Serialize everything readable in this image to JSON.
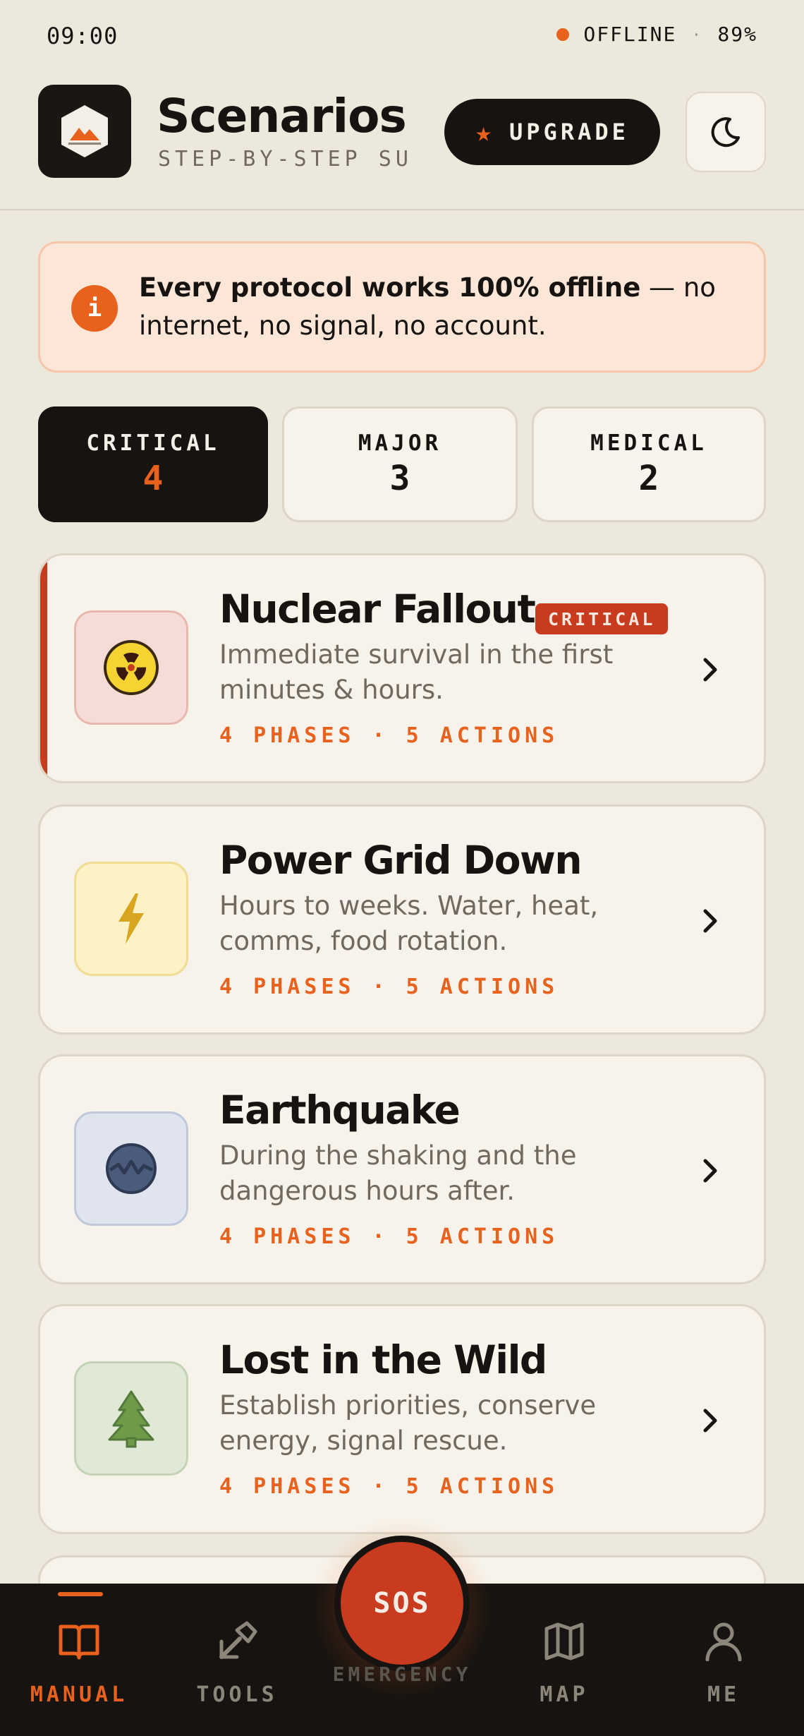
{
  "status_bar": {
    "time": "09:00",
    "network": "OFFLINE",
    "separator": "·",
    "battery": "89%"
  },
  "header": {
    "title": "Scenarios",
    "subtitle": "STEP-BY-STEP SU…",
    "upgrade_label": "UPGRADE",
    "upgrade_icon": "star-icon",
    "theme_icon": "moon-icon"
  },
  "banner": {
    "icon": "i",
    "bold": "Every protocol works 100% offline",
    "rest": " — no internet, no signal, no account."
  },
  "filters": [
    {
      "label": "CRITICAL",
      "count": "4",
      "active": true
    },
    {
      "label": "MAJOR",
      "count": "3",
      "active": false
    },
    {
      "label": "MEDICAL",
      "count": "2",
      "active": false
    }
  ],
  "scenarios": [
    {
      "title": "Nuclear Fallout",
      "badge": "CRITICAL",
      "description": "Immediate survival in the first minutes & hours.",
      "meta": "4 PHASES · 5 ACTIONS",
      "icon": "radiation-icon"
    },
    {
      "title": "Power Grid Down",
      "description": "Hours to weeks. Water, heat, comms, food rotation.",
      "meta": "4 PHASES · 5 ACTIONS",
      "icon": "lightning-icon"
    },
    {
      "title": "Earthquake",
      "description": "During the shaking and the dangerous hours after.",
      "meta": "4 PHASES · 5 ACTIONS",
      "icon": "earthquake-icon"
    },
    {
      "title": "Lost in the Wild",
      "description": "Establish priorities, conserve energy, signal rescue.",
      "meta": "4 PHASES · 5 ACTIONS",
      "icon": "tree-icon"
    }
  ],
  "nav": {
    "items": [
      {
        "label": "MANUAL",
        "icon": "book-icon",
        "active": true
      },
      {
        "label": "TOOLS",
        "icon": "tools-icon",
        "active": false
      },
      {
        "label": "MAP",
        "icon": "map-icon",
        "active": false
      },
      {
        "label": "ME",
        "icon": "user-icon",
        "active": false
      }
    ],
    "sos_label": "SOS",
    "sos_caption": "EMERGENCY"
  },
  "colors": {
    "background": "#ede8dc",
    "accent": "#e8621e",
    "critical": "#c83b1e",
    "ink": "#161310",
    "card": "#f7f3ea"
  }
}
